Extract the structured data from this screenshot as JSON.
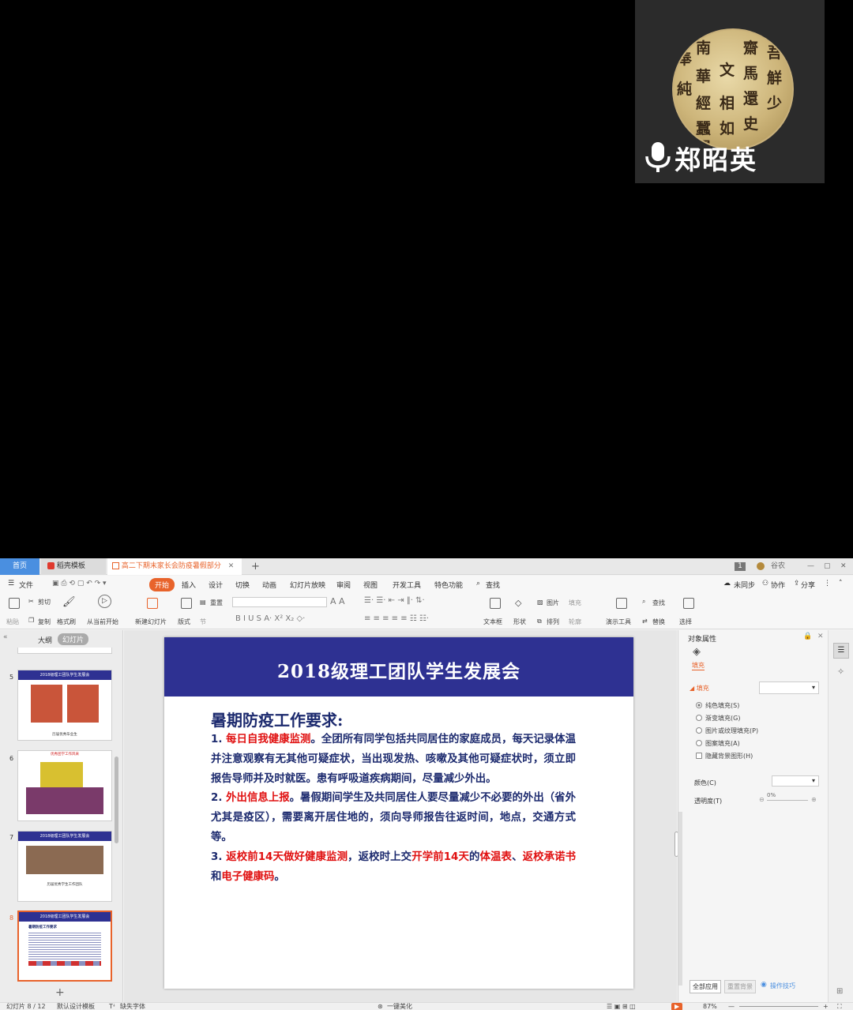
{
  "video": {
    "speaker_name": "郑昭英",
    "avatar_chars": [
      "吾",
      "齋",
      "觧",
      "少",
      "南",
      "文",
      "馬",
      "還",
      "史",
      "奉",
      "華",
      "經",
      "相",
      "如",
      "純",
      "蠶",
      "置"
    ]
  },
  "tabs": {
    "home": "首页",
    "template": "稻壳模板",
    "doc": "高二下期末家长会防疫暑假部分",
    "add": "+"
  },
  "window": {
    "badge": "1",
    "user": "谷农",
    "min": "—",
    "max": "▢",
    "close": "✕"
  },
  "menu": {
    "file": "文件",
    "items": [
      "开始",
      "插入",
      "设计",
      "切换",
      "动画",
      "幻灯片放映",
      "审阅",
      "视图",
      "开发工具",
      "特色功能"
    ],
    "search": "查找",
    "sync": "未同步",
    "collab": "协作",
    "share": "分享"
  },
  "ribbon": {
    "paste": "粘贴",
    "cut": "剪切",
    "copy": "复制",
    "format_painter": "格式刷",
    "from_current": "从当前开始",
    "new_slide": "新建幻灯片",
    "layout": "版式",
    "reset": "重置",
    "section": "节",
    "textbox": "文本框",
    "shape": "形状",
    "picture": "图片",
    "fill": "填充",
    "arrange": "排列",
    "outline": "轮廓",
    "presenter": "演示工具",
    "find": "查找",
    "replace": "替换",
    "select": "选择"
  },
  "leftpane": {
    "outline_tab": "大纲",
    "slides_tab": "幻灯片",
    "thumbs": [
      {
        "num": "5",
        "title": "2018级理工团队学生发展会",
        "caption": "历届优秀毕业生"
      },
      {
        "num": "6",
        "title": "优秀团学工作风采",
        "caption": ""
      },
      {
        "num": "7",
        "title": "2018级理工团队学生发展会",
        "caption": "历届优秀学生工作团队"
      },
      {
        "num": "8",
        "title": "2018级理工团队学生发展会",
        "caption": "暑期防疫工作要求"
      }
    ],
    "add": "+"
  },
  "slide": {
    "title": "2018级理工团队学生发展会",
    "subtitle": "暑期防疫工作要求:",
    "p1_num": "1. ",
    "p1_red": "每日自我健康监测",
    "p1_text": "。全团所有同学包括共同居住的家庭成员，每天记录体温并注意观察有无其他可疑症状，当出现发热、咳嗽及其他可疑症状时，须立即报告导师并及时就医。患有呼吸道疾病期间，尽量减少外出。",
    "p2_num": "2. ",
    "p2_red": "外出信息上报",
    "p2_text": "。暑假期间学生及共同居住人要尽量减少不必要的外出（省外尤其是疫区），需要离开居住地的，须向导师报告往返时间，地点，交通方式等。",
    "p3_num": "3. ",
    "p3_red1": "返校前14天做好健康监测",
    "p3_t1": "，返校时上交",
    "p3_red2": "开学前14天",
    "p3_t2": "的",
    "p3_red3": "体温表",
    "p3_t3": "、",
    "p3_red4": "返校承诺书",
    "p3_t4": "和",
    "p3_red5": "电子健康码",
    "p3_t5": "。"
  },
  "props": {
    "title": "对象属性",
    "fill_tab": "填充",
    "fill_section": "填充",
    "options": [
      "纯色填充(S)",
      "渐变填充(G)",
      "图片或纹理填充(P)",
      "图案填充(A)"
    ],
    "hide_bg": "隐藏背景图形(H)",
    "color": "颜色(C)",
    "transparency": "透明度(T)",
    "trans_value": "0%",
    "apply_all": "全部应用",
    "reset_bg": "重置背景",
    "tips": "操作技巧"
  },
  "status": {
    "slide": "幻灯片 8 / 12",
    "template": "默认设计模板",
    "font": "缺失字体",
    "beautify": "一键美化",
    "zoom": "87%"
  },
  "colors": {
    "slide_header": "#2e3192",
    "red": "#e01010",
    "accent": "#e8632b"
  }
}
